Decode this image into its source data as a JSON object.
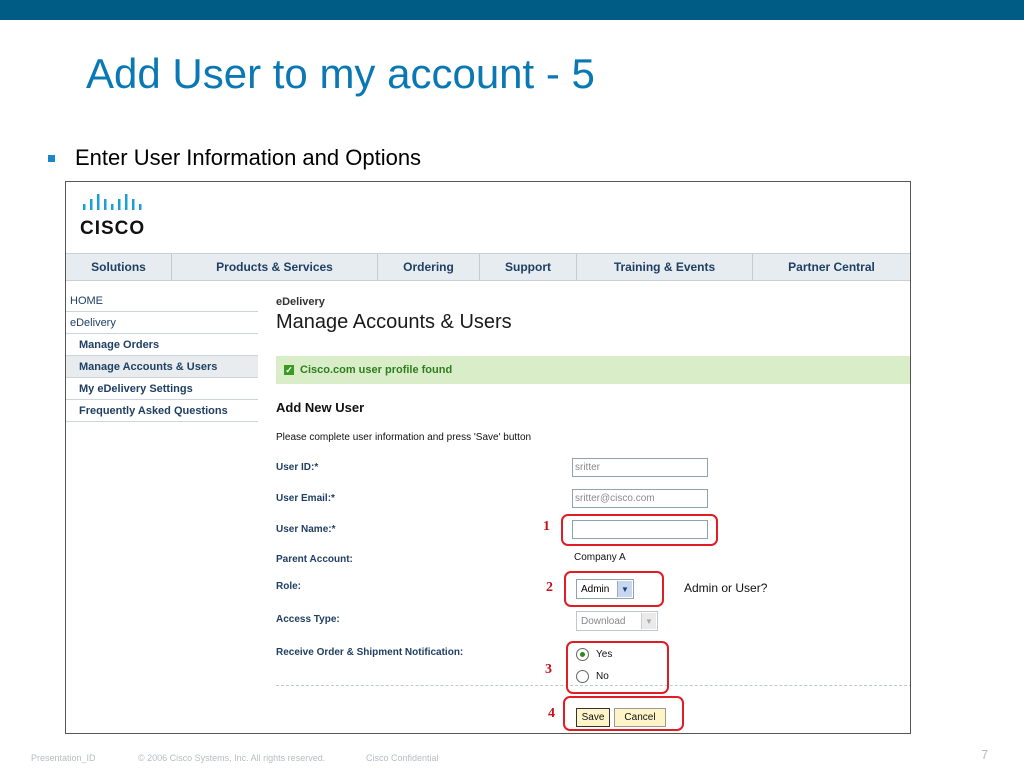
{
  "slide": {
    "title": "Add User to my account - 5",
    "bullet": "Enter User Information and Options",
    "page_number": "7",
    "footer": {
      "presentation_id": "Presentation_ID",
      "copyright": "© 2006 Cisco Systems, Inc. All rights reserved.",
      "confidential": "Cisco Confidential"
    }
  },
  "colors": {
    "top_bar": "#005b85",
    "title": "#0a78b4",
    "annotation": "#e01c24",
    "success_bar": "#d9eec8"
  },
  "app": {
    "logo_text": "CISCO",
    "nav": [
      "Solutions",
      "Products & Services",
      "Ordering",
      "Support",
      "Training & Events",
      "Partner Central"
    ],
    "sidebar": [
      {
        "label": "HOME",
        "sub": false
      },
      {
        "label": "eDelivery",
        "sub": false
      },
      {
        "label": "Manage Orders",
        "sub": true
      },
      {
        "label": "Manage Accounts & Users",
        "sub": true,
        "active": true
      },
      {
        "label": "My eDelivery Settings",
        "sub": true
      },
      {
        "label": "Frequently Asked Questions",
        "sub": true
      }
    ],
    "breadcrumb": "eDelivery",
    "page_heading": "Manage Accounts & Users",
    "status_message": "Cisco.com user profile found",
    "section_title": "Add New User",
    "instruction": "Please complete user information and press 'Save' button",
    "form": {
      "user_id": {
        "label": "User ID:*",
        "value": "sritter"
      },
      "user_email": {
        "label": "User Email:*",
        "value": "sritter@cisco.com"
      },
      "user_name": {
        "label": "User Name:*",
        "value": ""
      },
      "parent_account": {
        "label": "Parent Account:",
        "value": "Company A"
      },
      "role": {
        "label": "Role:",
        "value": "Admin"
      },
      "access_type": {
        "label": "Access Type:",
        "value": "Download"
      },
      "notification": {
        "label": "Receive Order & Shipment Notification:",
        "options": [
          "Yes",
          "No"
        ],
        "selected": "Yes"
      }
    },
    "buttons": {
      "save": "Save",
      "cancel": "Cancel"
    },
    "role_hint": "Admin or User?"
  },
  "annotations": [
    "1",
    "2",
    "3",
    "4"
  ]
}
